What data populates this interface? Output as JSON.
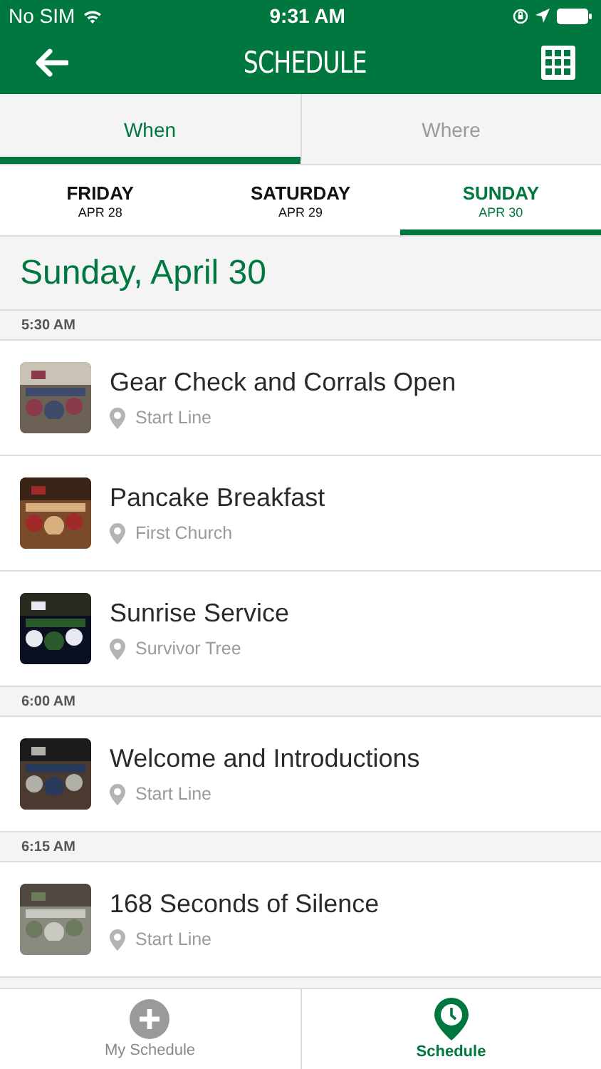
{
  "status_bar": {
    "carrier": "No SIM",
    "time": "9:31 AM"
  },
  "nav": {
    "title": "SCHEDULE"
  },
  "view_tabs": [
    {
      "label": "When",
      "selected": true
    },
    {
      "label": "Where",
      "selected": false
    }
  ],
  "day_tabs": [
    {
      "day": "FRIDAY",
      "date": "APR 28",
      "selected": false
    },
    {
      "day": "SATURDAY",
      "date": "APR 29",
      "selected": false
    },
    {
      "day": "SUNDAY",
      "date": "APR 30",
      "selected": true
    }
  ],
  "date_heading": "Sunday, April 30",
  "sections": [
    {
      "time": "5:30 AM",
      "events": [
        {
          "title": "Gear Check and Corrals Open",
          "location": "Start Line"
        },
        {
          "title": "Pancake Breakfast",
          "location": "First Church"
        },
        {
          "title": "Sunrise Service",
          "location": "Survivor Tree"
        }
      ]
    },
    {
      "time": "6:00 AM",
      "events": [
        {
          "title": "Welcome and Introductions",
          "location": "Start Line"
        }
      ]
    },
    {
      "time": "6:15 AM",
      "events": [
        {
          "title": "168 Seconds of Silence",
          "location": "Start Line"
        }
      ]
    }
  ],
  "bottom_tabs": [
    {
      "label": "My Schedule",
      "kind": "add",
      "selected": false
    },
    {
      "label": "Schedule",
      "kind": "schedule",
      "selected": true
    }
  ]
}
